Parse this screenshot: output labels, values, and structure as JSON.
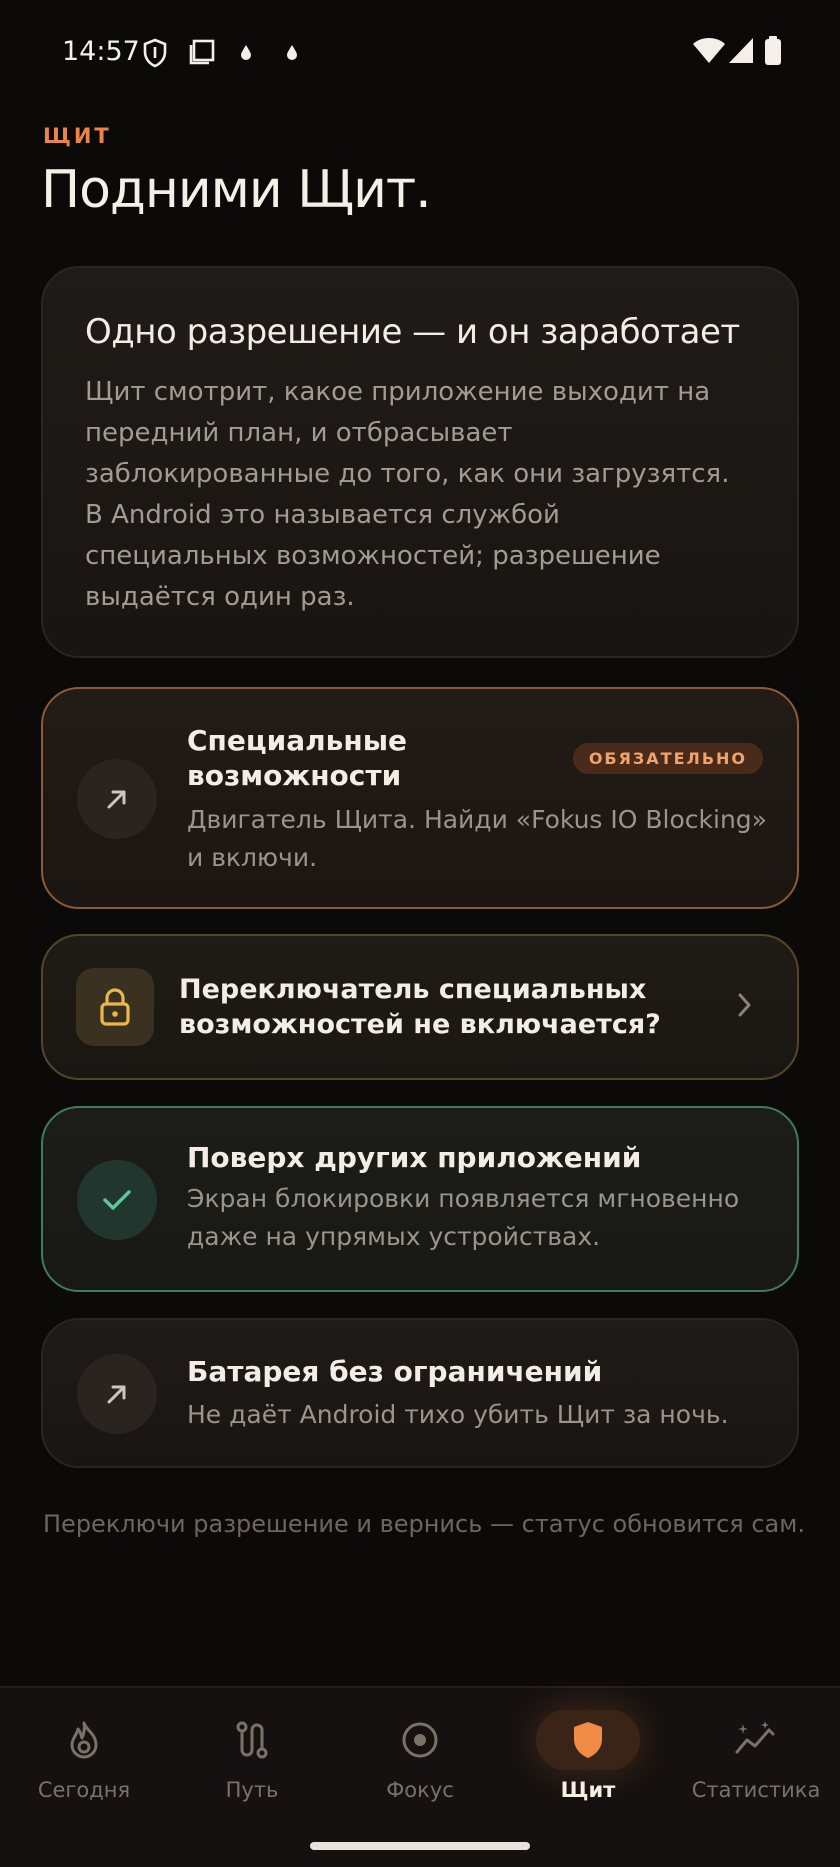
{
  "status_bar": {
    "time": "14:57"
  },
  "header": {
    "eyebrow": "ЩИТ",
    "title": "Подними Щит."
  },
  "info_card": {
    "title": "Одно разрешение — и он заработает",
    "lines": [
      "Щит смотрит, какое приложение выходит на",
      "передний план, и отбрасывает",
      "заблокированные до того, как они загрузятся.",
      "В Android это называется службой",
      "специальных возможностей; разрешение",
      "выдаётся один раз."
    ]
  },
  "permissions": {
    "accessibility": {
      "title_line1": "Специальные",
      "title_line2": "возможности",
      "badge": "ОБЯЗАТЕЛЬНО",
      "desc_line1": "Двигатель Щита. Найди «Fokus IO Blocking»",
      "desc_line2": "и включи.",
      "icon": "arrow-up-right-icon"
    },
    "help": {
      "text_line1": "Переключатель специальных",
      "text_line2": "возможностей не включается?",
      "icon": "lock-icon"
    },
    "overlay": {
      "title": "Поверх других приложений",
      "desc_line1": "Экран блокировки появляется мгновенно",
      "desc_line2": "даже на упрямых устройствах.",
      "icon": "check-icon",
      "status": "granted"
    },
    "battery": {
      "title": "Батарея без ограничений",
      "desc": "Не даёт Android тихо убить Щит за ночь.",
      "icon": "arrow-up-right-icon"
    }
  },
  "footer_note": "Переключи разрешение и вернись — статус обновится сам.",
  "nav": {
    "items": [
      {
        "label": "Сегодня",
        "icon": "flame-icon"
      },
      {
        "label": "Путь",
        "icon": "path-icon"
      },
      {
        "label": "Фокус",
        "icon": "target-icon"
      },
      {
        "label": "Щит",
        "icon": "shield-icon",
        "active": true
      },
      {
        "label": "Статистика",
        "icon": "stats-icon"
      }
    ]
  },
  "colors": {
    "accent": "#e8854a",
    "success": "#5ec79a",
    "warning": "#e9b74a",
    "background": "#0c0a08"
  }
}
